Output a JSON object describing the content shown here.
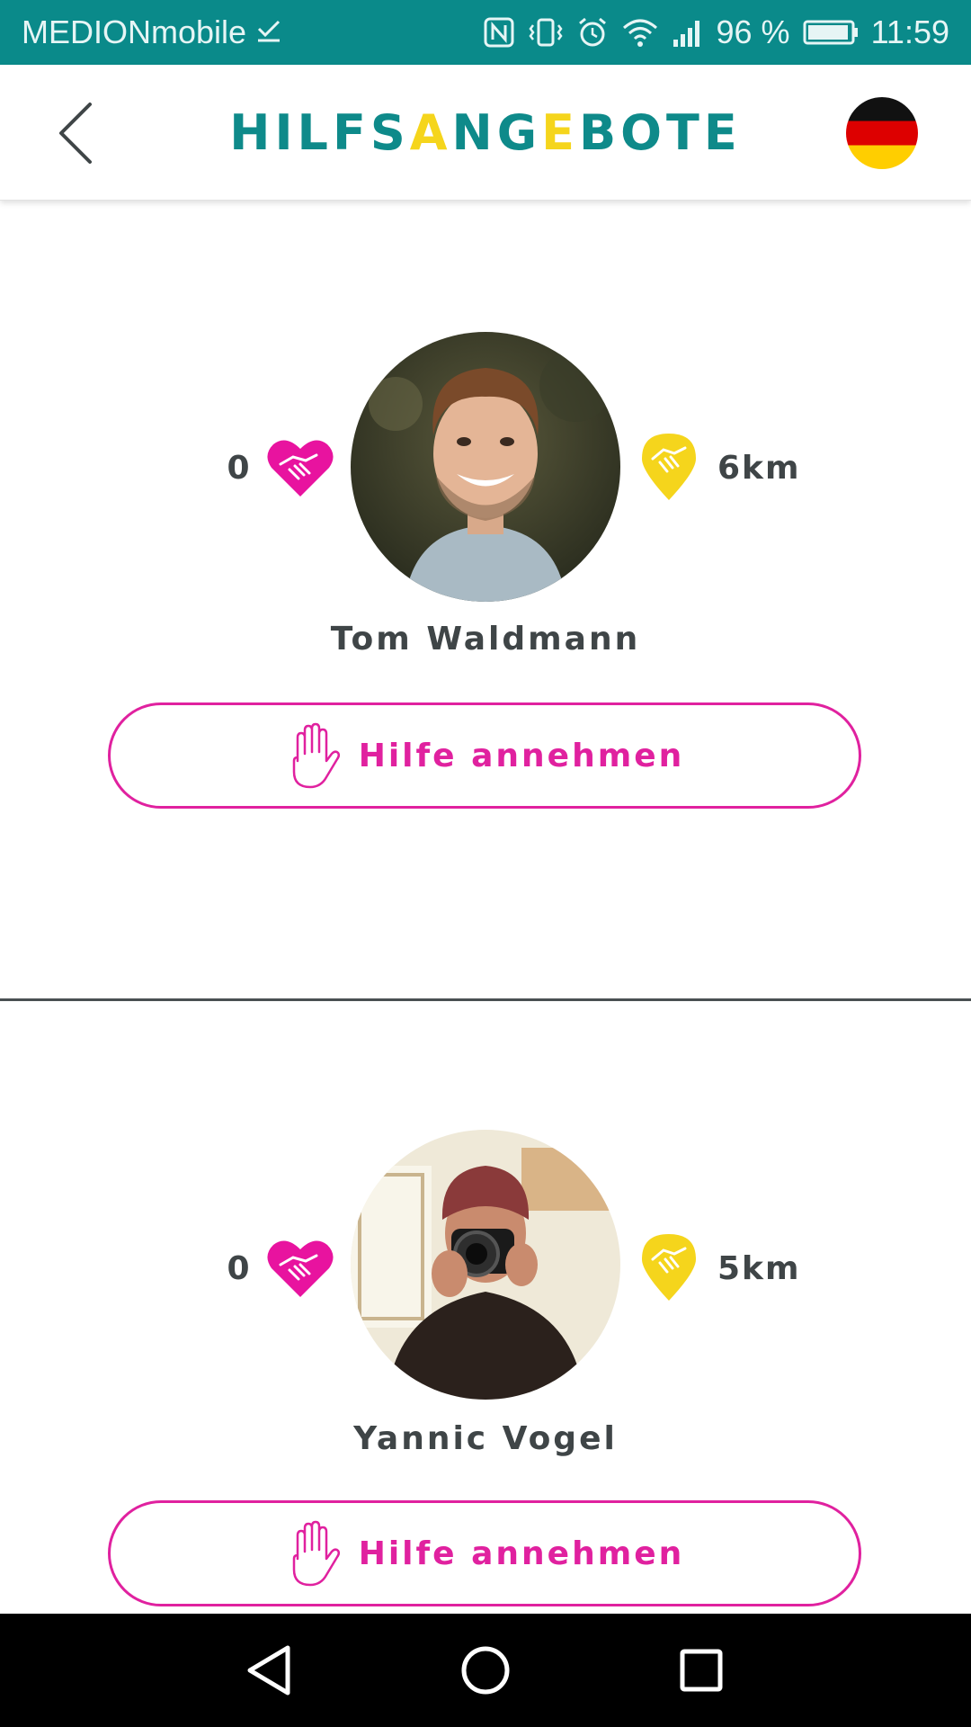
{
  "status_bar": {
    "carrier": "MEDIONmobile",
    "battery": "96 %",
    "time": "11:59"
  },
  "header": {
    "title_parts": [
      "HILFS",
      "A",
      "NG",
      "E",
      "BOTE"
    ]
  },
  "offers": [
    {
      "name": "Tom Waldmann",
      "rating_count": "0",
      "distance": "6km",
      "button_label": "Hilfe annehmen"
    },
    {
      "name": "Yannic Vogel",
      "rating_count": "0",
      "distance": "5km",
      "button_label": "Hilfe annehmen"
    }
  ],
  "icons": {
    "back": "chevron-left-icon",
    "flag": "german-flag-icon",
    "rating": "heart-handshake-icon",
    "distance": "location-pin-handshake-icon",
    "help": "raised-hand-icon"
  },
  "colors": {
    "teal": "#0e8a8a",
    "status_bar": "#0a8a8a",
    "yellow": "#f5d51c",
    "magenta": "#e0219f",
    "text": "#3f4547"
  }
}
